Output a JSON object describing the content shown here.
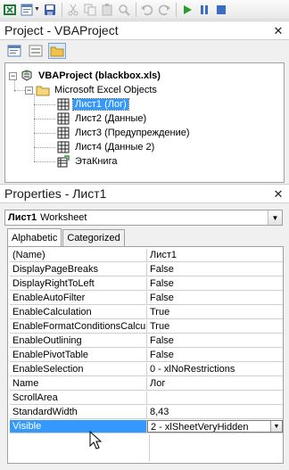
{
  "toolbar": {
    "icons": [
      "excel-icon",
      "insert-module-icon",
      "save-icon",
      "cut-icon",
      "copy-icon",
      "paste-icon",
      "find-icon",
      "undo-icon",
      "redo-icon",
      "run-icon",
      "break-icon",
      "reset-icon"
    ]
  },
  "project": {
    "title": "Project - VBAProject",
    "root_label": "VBAProject (blackbox.xls)",
    "folder_label": "Microsoft Excel Objects",
    "items": [
      {
        "label": "Лист1 (Лог)",
        "selected": true
      },
      {
        "label": "Лист2 (Данные)",
        "selected": false
      },
      {
        "label": "Лист3 (Предупреждение)",
        "selected": false
      },
      {
        "label": "Лист4 (Данные 2)",
        "selected": false
      },
      {
        "label": "ЭтаКнига",
        "selected": false
      }
    ]
  },
  "properties": {
    "title": "Properties - Лист1",
    "object_name": "Лист1",
    "object_type": "Worksheet",
    "tabs": [
      {
        "label": "Alphabetic",
        "active": true
      },
      {
        "label": "Categorized",
        "active": false
      }
    ],
    "rows": [
      {
        "name": "(Name)",
        "value": "Лист1"
      },
      {
        "name": "DisplayPageBreaks",
        "value": "False"
      },
      {
        "name": "DisplayRightToLeft",
        "value": "False"
      },
      {
        "name": "EnableAutoFilter",
        "value": "False"
      },
      {
        "name": "EnableCalculation",
        "value": "True"
      },
      {
        "name": "EnableFormatConditionsCalcula",
        "value": "True"
      },
      {
        "name": "EnableOutlining",
        "value": "False"
      },
      {
        "name": "EnablePivotTable",
        "value": "False"
      },
      {
        "name": "EnableSelection",
        "value": "0 - xlNoRestrictions"
      },
      {
        "name": "Name",
        "value": "Лог"
      },
      {
        "name": "ScrollArea",
        "value": ""
      },
      {
        "name": "StandardWidth",
        "value": "8,43"
      },
      {
        "name": "Visible",
        "value": "2 - xlSheetVeryHidden",
        "selected": true
      }
    ]
  },
  "colors": {
    "selection": "#3399ff",
    "pane_border": "#a0a0a0"
  }
}
